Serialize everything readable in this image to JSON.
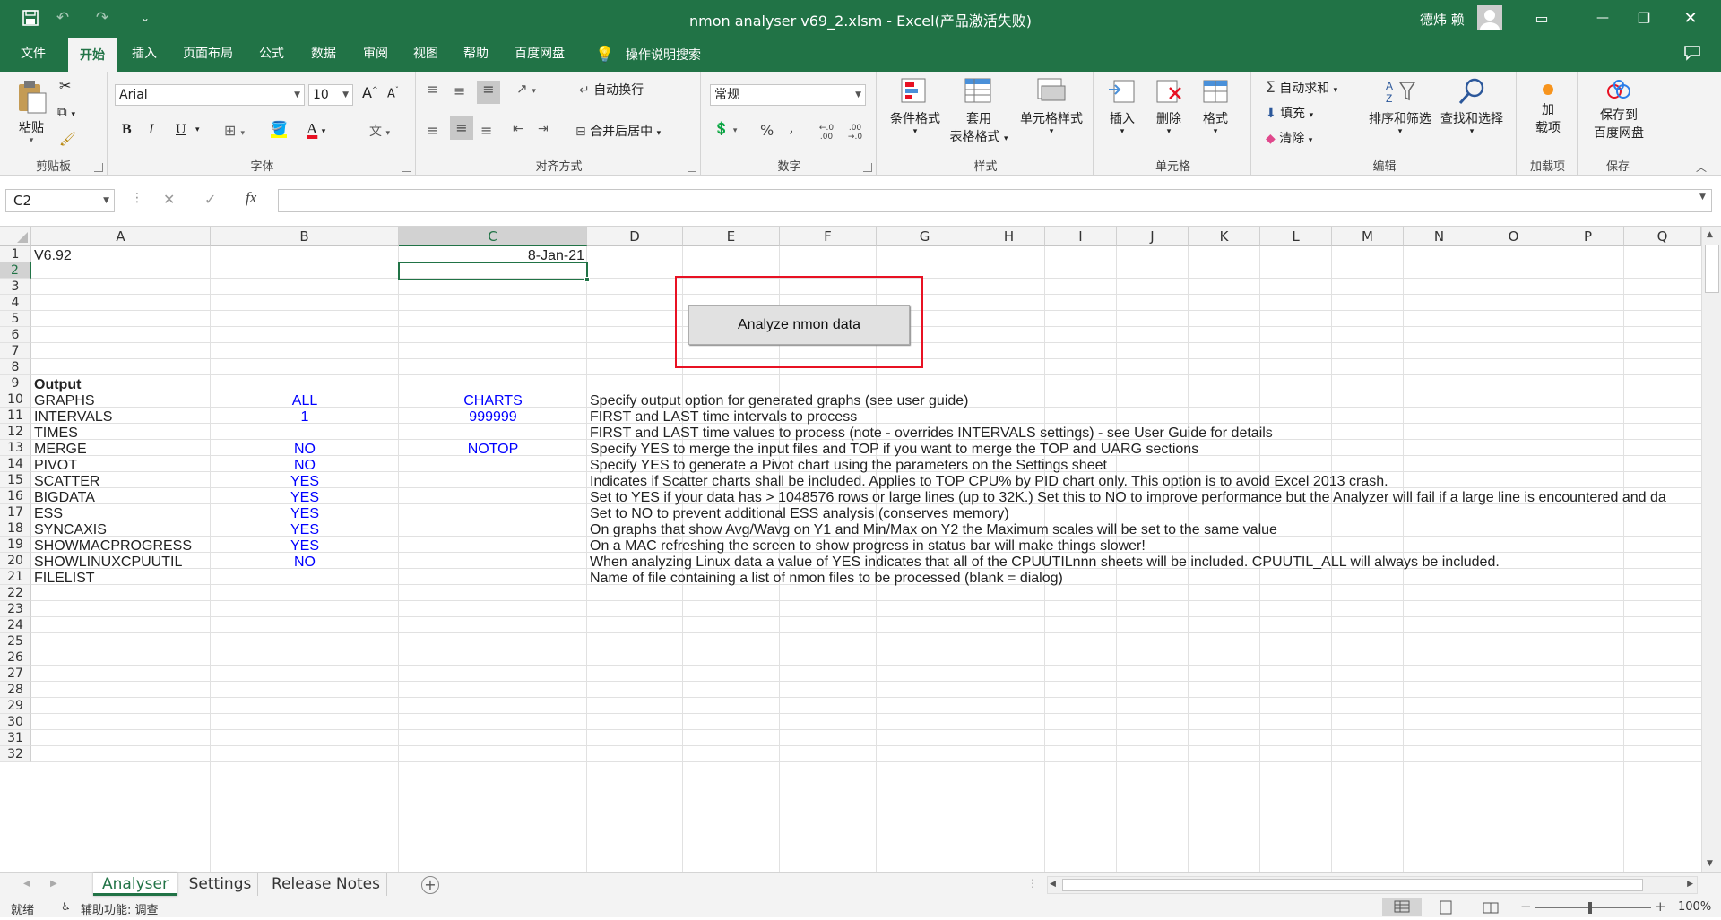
{
  "titlebar": {
    "title": "nmon analyser v69_2.xlsm  -  Excel(产品激活失败)",
    "user": "德炜 赖",
    "save_icon": "💾",
    "undo_icon": "↶",
    "redo_icon": "↷",
    "qat_more": "⌄",
    "ribbon_display_icon": "▭",
    "minimize": "—",
    "restore": "❐",
    "close": "✕"
  },
  "tabs": [
    "文件",
    "开始",
    "插入",
    "页面布局",
    "公式",
    "数据",
    "审阅",
    "视图",
    "帮助",
    "百度网盘"
  ],
  "tell_me": "操作说明搜索",
  "share_icon": "💬",
  "ribbon": {
    "clipboard": {
      "paste": "粘贴",
      "label": "剪贴板"
    },
    "font": {
      "name": "Arial",
      "size": "10",
      "bold": "B",
      "italic": "I",
      "underline": "U",
      "label": "字体",
      "grow": "A",
      "shrink": "A",
      "phonetic": "文"
    },
    "alignment": {
      "wrap": "自动换行",
      "merge": "合并后居中",
      "label": "对齐方式"
    },
    "number": {
      "format": "常规",
      "percent": "%",
      "comma": ",",
      "inc_dec": "←.0 .00",
      "dec_dec": ".00 →.0",
      "label": "数字"
    },
    "styles": {
      "cond": "条件格式",
      "table1": "套用",
      "table2": "表格格式",
      "cell": "单元格样式",
      "label": "样式"
    },
    "cells": {
      "insert": "插入",
      "delete": "删除",
      "format": "格式",
      "label": "单元格"
    },
    "editing": {
      "autosum": "自动求和",
      "fill": "填充",
      "clear": "清除",
      "sort": "排序和筛选",
      "find": "查找和选择",
      "label": "编辑"
    },
    "addins": {
      "line1": "加",
      "line2": "载项",
      "label": "加载项"
    },
    "save": {
      "line1": "保存到",
      "line2": "百度网盘",
      "label": "保存"
    }
  },
  "formula_bar": {
    "name_box": "C2",
    "cancel": "✕",
    "enter": "✓",
    "fx": "fx",
    "content": ""
  },
  "columns": [
    "A",
    "B",
    "C",
    "D",
    "E",
    "F",
    "G",
    "H",
    "I",
    "J",
    "K",
    "L",
    "M",
    "N",
    "O",
    "P",
    "Q"
  ],
  "rows": [
    "1",
    "2",
    "3",
    "4",
    "5",
    "6",
    "7",
    "8",
    "9",
    "10",
    "11",
    "12",
    "13",
    "14",
    "15",
    "16",
    "17",
    "18",
    "19",
    "20",
    "21",
    "22",
    "23",
    "24",
    "25",
    "26",
    "27",
    "28",
    "29",
    "30",
    "31",
    "32"
  ],
  "cells": {
    "r1": {
      "a": "V6.92",
      "c": "8-Jan-21"
    },
    "r9": {
      "a": "Output"
    },
    "r10": {
      "a": "GRAPHS",
      "b": "ALL",
      "c": "CHARTS",
      "d": "Specify output option for generated graphs (see user guide)"
    },
    "r11": {
      "a": "INTERVALS",
      "b": "1",
      "c": "999999",
      "d": "FIRST and LAST time intervals to process"
    },
    "r12": {
      "a": "TIMES",
      "d": "FIRST and LAST time values to process (note - overrides INTERVALS settings) - see User Guide for details"
    },
    "r13": {
      "a": "MERGE",
      "b": "NO",
      "c": "NOTOP",
      "d": "Specify YES to merge the input files and TOP if you want to merge the TOP and UARG sections"
    },
    "r14": {
      "a": "PIVOT",
      "b": "NO",
      "d": "Specify YES to generate a Pivot chart using the parameters on the Settings sheet"
    },
    "r15": {
      "a": "SCATTER",
      "b": "YES",
      "d": "Indicates if Scatter charts shall be included.  Applies to TOP CPU% by PID chart only.  This option is to avoid Excel 2013 crash."
    },
    "r16": {
      "a": "BIGDATA",
      "b": "YES",
      "d": "Set to YES if your data has > 1048576 rows or large lines (up to 32K.)  Set this to NO to improve performance but the Analyzer will fail if a large line is encountered and da"
    },
    "r17": {
      "a": "ESS",
      "b": "YES",
      "d": "Set to NO to prevent additional ESS analysis (conserves memory)"
    },
    "r18": {
      "a": "SYNCAXIS",
      "b": "YES",
      "d": "On graphs that show Avg/Wavg on Y1 and Min/Max on Y2 the Maximum scales will be set to the same value"
    },
    "r19": {
      "a": "SHOWMACPROGRESS",
      "b": "YES",
      "d": "On a MAC refreshing the screen to show progress in status bar will make things slower!"
    },
    "r20": {
      "a": "SHOWLINUXCPUUTIL",
      "b": "NO",
      "d": "When analyzing Linux data a value of YES indicates that all of the CPUUTILnnn sheets will be included.  CPUUTIL_ALL will always be included."
    },
    "r21": {
      "a": "FILELIST",
      "d": "Name of file containing a list of nmon files to be processed (blank = dialog)"
    }
  },
  "analyze_button": "Analyze nmon data",
  "sheets": [
    "Analyser",
    "Settings",
    "Release Notes"
  ],
  "add_sheet": "+",
  "status": {
    "ready": "就绪",
    "accessibility": "辅助功能: 调查",
    "zoom": "100%"
  },
  "colors": {
    "excel_green": "#217346",
    "blue_text": "#0000ff",
    "highlight_red": "#e81123"
  }
}
